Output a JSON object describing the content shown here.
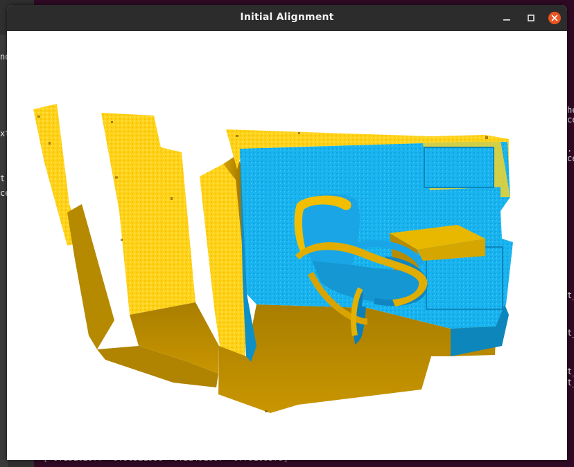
{
  "window": {
    "title": "Initial Alignment"
  },
  "titlebar_controls": {
    "minimize_icon": "minimize-icon",
    "maximize_icon": "maximize-icon",
    "close_icon": "close-icon"
  },
  "colors": {
    "titlebar_bg": "#2c2c2c",
    "close_button": "#e95420",
    "source_cloud": "#ffd21a",
    "target_cloud": "#19b4f0",
    "terminal_bg": "#300a24",
    "canvas_bg": "#ffffff"
  },
  "terminal_fragments": {
    "frag_1": "no",
    "frag_2": "xt",
    "frag_3": "t",
    "frag_4": "ce",
    "frag_5": "he",
    "frag_6": "ce",
    "frag_7": ".",
    "frag_8": "ce",
    "frag_9": "t_",
    "frag_10": "t_",
    "frag_11": "t_",
    "frag_12": "t_",
    "bottom_line": "[ 0.15102977  0.96521958  0.21491607  0.79108579]"
  }
}
